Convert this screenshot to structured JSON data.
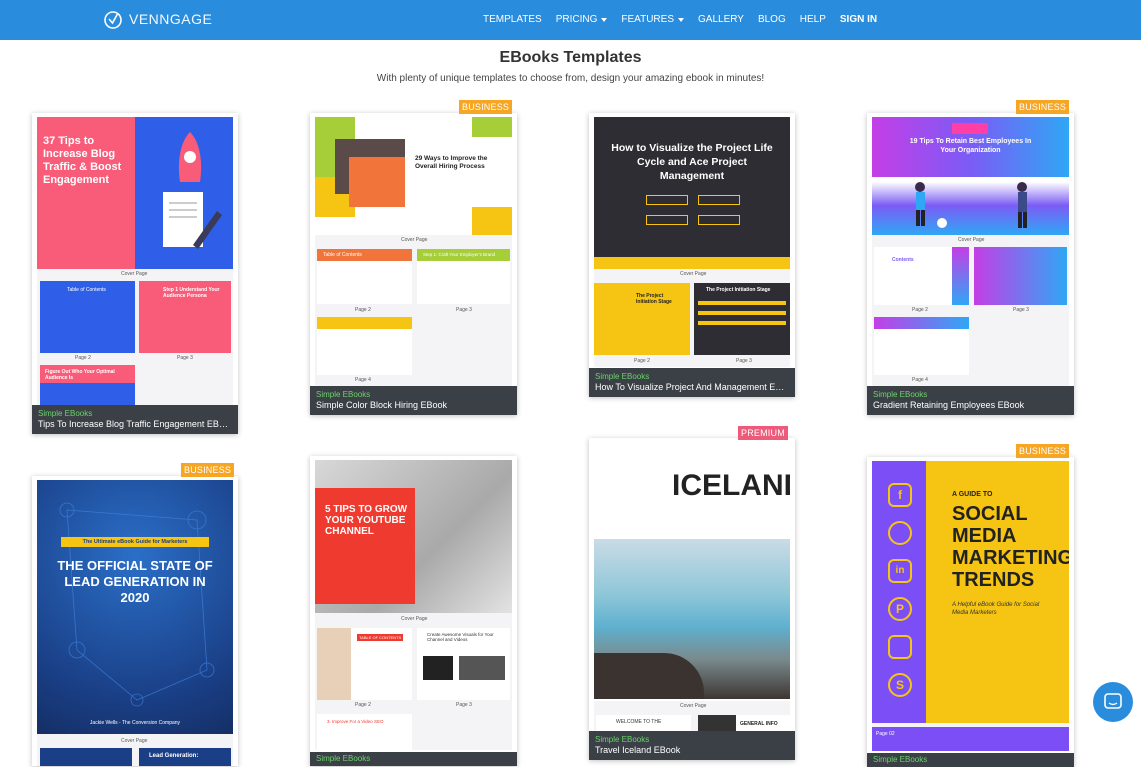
{
  "brand": {
    "name": "VENNGAGE",
    "color": "#2a8cdc"
  },
  "nav": [
    {
      "label": "TEMPLATES",
      "dropdown": false
    },
    {
      "label": "PRICING",
      "dropdown": true
    },
    {
      "label": "FEATURES",
      "dropdown": true
    },
    {
      "label": "GALLERY",
      "dropdown": false
    },
    {
      "label": "BLOG",
      "dropdown": false
    },
    {
      "label": "HELP",
      "dropdown": false
    },
    {
      "label": "SIGN IN",
      "dropdown": false
    }
  ],
  "page": {
    "title": "EBooks Templates",
    "subtitle": "With plenty of unique templates to choose from, design your amazing ebook in minutes!"
  },
  "cards": [
    {
      "category": "Simple EBooks",
      "title": "Tips To Increase Blog Traffic Engagement EBook",
      "badge": "",
      "cover_title": "37 Tips to Increase Blog Traffic & Boost Engagement",
      "pages": [
        "Cover Page",
        "Page 2",
        "Page 3"
      ],
      "inner": [
        "Table of Contents",
        "Step 1 Understand Your Audience Persona",
        "Figure Out Who Your Optimal Audience Is"
      ]
    },
    {
      "category": "Simple EBooks",
      "title": "Simple Color Block Hiring EBook",
      "badge": "BUSINESS",
      "cover_title": "29 Ways to Improve the Overall Hiring Process",
      "pages": [
        "Cover Page",
        "Page 2",
        "Page 3",
        "Page 4"
      ],
      "inner": [
        "Table of Contents",
        "Step 1: Craft Your Employer's Brand"
      ]
    },
    {
      "category": "Simple EBooks",
      "title": "How To Visualize Project And Management EBook",
      "badge": "",
      "cover_title": "How to Visualize the Project Life Cycle and Ace Project Management",
      "pages": [
        "Cover Page",
        "Page 2",
        "Page 3"
      ],
      "inner": [
        "The Project Initiation Stage",
        "The Project Initiation Stage"
      ]
    },
    {
      "category": "Simple EBooks",
      "title": "Gradient Retaining Employees EBook",
      "badge": "BUSINESS",
      "cover_title": "19 Tips To Retain Best Employees In Your Organization",
      "pages": [
        "Cover Page",
        "Page 2",
        "Page 3",
        "Page 4"
      ],
      "inner": [
        "Contents"
      ]
    },
    {
      "category": "",
      "title": "",
      "badge": "BUSINESS",
      "cover_title": "THE OFFICIAL STATE OF LEAD GENERATION IN 2020",
      "cover_kicker": "The Ultimate eBook Guide for Marketers",
      "cover_author": "Jackie Wells - The Conversion Company",
      "pages": [
        "Cover Page"
      ],
      "inner": [
        "Lead Generation:"
      ]
    },
    {
      "category": "Simple EBooks",
      "title": "",
      "badge": "",
      "cover_title": "5 TIPS TO GROW YOUR YOUTUBE CHANNEL",
      "pages": [
        "Cover Page",
        "Page 2",
        "Page 3"
      ],
      "inner": [
        "TABLE OF CONTENTS",
        "Create Awesome Visuals for Your Channel and Videos",
        "3. Improve For a Video SEO"
      ]
    },
    {
      "category": "Simple EBooks",
      "title": "Travel Iceland EBook",
      "badge": "PREMIUM",
      "cover_title": "ICELAND",
      "pages": [
        "Cover Page"
      ],
      "inner": [
        "WELCOME TO THE",
        "GENERAL INFO"
      ]
    },
    {
      "category": "Simple EBooks",
      "title": "",
      "badge": "BUSINESS",
      "cover_title": "SOCIAL MEDIA MARKETING TRENDS",
      "cover_kicker": "A GUIDE TO",
      "cover_sub": "A Helpful eBook Guide for Social Media Marketers",
      "pages": [
        "Page 02"
      ],
      "inner": []
    }
  ]
}
